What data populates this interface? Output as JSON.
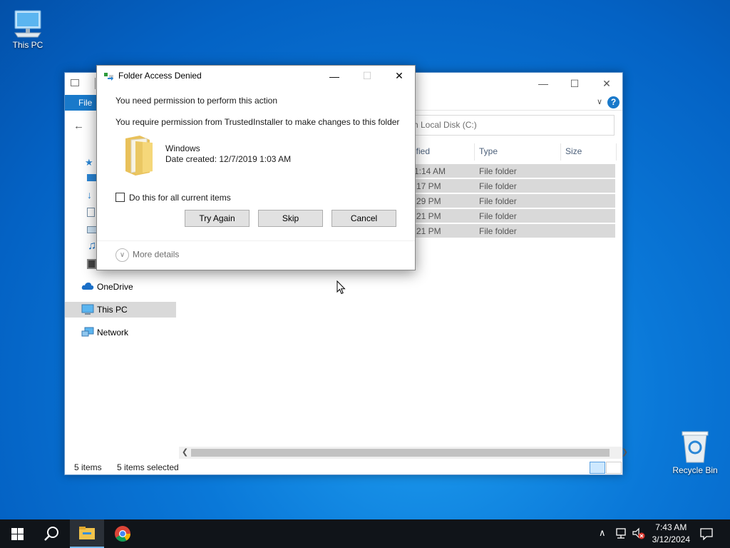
{
  "desktop": {
    "icons": [
      {
        "label": "This PC",
        "icon": "monitor-icon"
      },
      {
        "label": "Recycle Bin",
        "icon": "recycle-bin-icon"
      }
    ]
  },
  "explorer": {
    "ribbon": {
      "file_tab": "File"
    },
    "search_placeholder": "ch Local Disk (C:)",
    "columns": [
      "ified",
      "Type",
      "Size"
    ],
    "rows": [
      {
        "modified": "1:14 AM",
        "type": "File folder"
      },
      {
        "modified": "17 PM",
        "type": "File folder"
      },
      {
        "modified": "29 PM",
        "type": "File folder"
      },
      {
        "modified": "21 PM",
        "type": "File folder"
      },
      {
        "modified": "21 PM",
        "type": "File folder"
      }
    ],
    "nav": [
      {
        "label": "OneDrive",
        "icon": "cloud-icon"
      },
      {
        "label": "This PC",
        "icon": "monitor-icon",
        "selected": true
      },
      {
        "label": "Network",
        "icon": "network-icon"
      }
    ],
    "status": {
      "items": "5 items",
      "selected": "5 items selected"
    }
  },
  "dialog": {
    "title": "Folder Access Denied",
    "heading": "You need permission to perform this action",
    "message": "You require permission from TrustedInstaller to make changes to this folder",
    "folder_name": "Windows",
    "date_created": "Date created: 12/7/2019 1:03 AM",
    "checkbox_label": "Do this for all current items",
    "buttons": {
      "try_again": "Try Again",
      "skip": "Skip",
      "cancel": "Cancel"
    },
    "more_details": "More details"
  },
  "taskbar": {
    "time": "7:43 AM",
    "date": "3/12/2024"
  },
  "colors": {
    "accent": "#1979ca",
    "taskbar": "#101419"
  }
}
